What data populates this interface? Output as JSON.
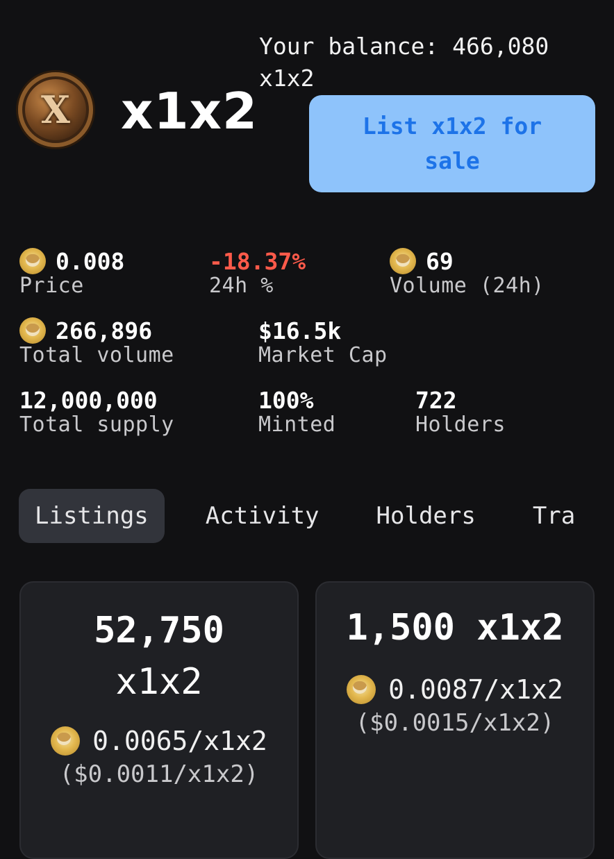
{
  "token": {
    "name": "x1x2",
    "logo_icon": "x1x2-coin-logo"
  },
  "balance": {
    "text": "Your balance: 466,080 x1x2"
  },
  "actions": {
    "list_button": "List x1x2 for sale"
  },
  "stats": {
    "price": {
      "value": "0.008",
      "label": "Price"
    },
    "change": {
      "value": "-18.37%",
      "label": "24h %",
      "color": "#ff5a4a"
    },
    "volume24h": {
      "value": "69",
      "label": "Volume (24h)"
    },
    "total_volume": {
      "value": "266,896",
      "label": "Total volume"
    },
    "market_cap": {
      "value": "$16.5k",
      "label": "Market Cap"
    },
    "total_supply": {
      "value": "12,000,000",
      "label": "Total supply"
    },
    "minted": {
      "value": "100%",
      "label": "Minted"
    },
    "holders": {
      "value": "722",
      "label": "Holders"
    }
  },
  "tabs": [
    {
      "label": "Listings",
      "active": true
    },
    {
      "label": "Activity"
    },
    {
      "label": "Holders"
    },
    {
      "label": "Tra"
    }
  ],
  "listings": [
    {
      "amount": "52,750",
      "unit": "x1x2",
      "price": "0.0065/x1x2",
      "usd": "($0.0011/x1x2)"
    },
    {
      "amount": "1,500 x1x2",
      "price": "0.0087/x1x2",
      "usd": "($0.0015/x1x2)"
    }
  ],
  "colors": {
    "accent_button_bg": "#8ec3fb",
    "accent_button_text": "#1d73e8",
    "background": "#111113"
  }
}
